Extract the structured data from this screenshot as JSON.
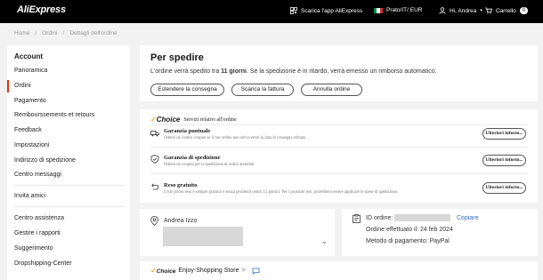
{
  "header": {
    "logo": "AliExpress",
    "app_label": "Scarica l'app AliExpress",
    "locale_label": "Prato/IT/ EUR",
    "user_label": "Hi, Andrea",
    "cart_label": "Carrello",
    "cart_count": "0"
  },
  "breadcrumb": [
    "Home",
    "Ordini",
    "Dettagli dell'ordine"
  ],
  "sidebar": {
    "title": "Account",
    "items": [
      "Panoramica",
      "Ordini",
      "Pagamento",
      "Rembourssements et retours",
      "Feedback",
      "Impostazioni",
      "Indirizzo di spedizione",
      "Centro messaggi",
      "Invita amici",
      "Centro assistenza",
      "Gestire i rapporti",
      "Suggerimento",
      "Dropshipping-Center"
    ],
    "active_index": 1
  },
  "status": {
    "title": "Per spedire",
    "desc_before": "L'ordine verrà spedito tra ",
    "desc_bold": "11 giorni",
    "desc_after": ". Se la spedizione è in ritardo, verrà emesso un rimborso automatico.",
    "buttons": [
      "Estendere la consegna",
      "Scarica la fattura",
      "Annulla ordine"
    ]
  },
  "guarantees": {
    "choice_label": "Choice",
    "header": "Servizi relativi all'ordine",
    "items": [
      {
        "title": "Garanzia puntuale",
        "desc": "Ottieni un codice coupon se il tuo ordine non arriva entro la data di consegna stimata",
        "button": "Ulteriori inform..."
      },
      {
        "title": "Garanzia di spedizione",
        "desc": "Ottieni un coupon per la spedizione di ordini annullati",
        "button": "Ulteriori inform..."
      },
      {
        "title": "Reso gratuito",
        "desc": "Il tuo primo reso è sempre gratuito e senza problemi (entro 15 giorni). Per i prossimi resi, potrebbero essere applicate le spese di spedizione.",
        "button": "Ulteriori inform..."
      }
    ]
  },
  "address": {
    "name": "Andrea Izzo"
  },
  "order": {
    "id_label": "ID ordine:",
    "copy_label": "Copiare",
    "date_line": "Ordine effettuato il: 24 feb 2024",
    "payment_line": "Metodo di pagamento: PayPal"
  },
  "store": {
    "choice_label": "Choice",
    "name": "Enjoy-Shopping Store",
    "chevron": ">"
  },
  "colors": {
    "accent": "#e62e04",
    "choice": "#f5a623",
    "link": "#2e6ecc"
  }
}
